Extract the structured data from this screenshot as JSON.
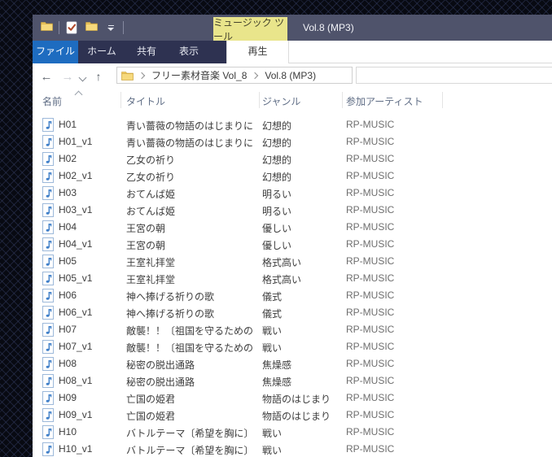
{
  "titlebar": {
    "contextual_tab": "ミュージック ツール",
    "title": "Vol.8 (MP3)"
  },
  "ribbon": {
    "file": "ファイル",
    "home": "ホーム",
    "share": "共有",
    "view": "表示",
    "play": "再生"
  },
  "nav": {
    "back": "←",
    "forward": "→",
    "up": "↑"
  },
  "breadcrumb": {
    "root_folder": "フリー素材音楽 Vol_8",
    "current": "Vol.8 (MP3)"
  },
  "columns": {
    "name": "名前",
    "title": "タイトル",
    "genre": "ジャンル",
    "artist": "参加アーティスト"
  },
  "colors": {
    "accent_blue": "#1e6cc0",
    "titlebar": "#4f536b",
    "tabstrip_dark": "#2e3251",
    "contextual_tab_yellow": "#e9e58b"
  },
  "rows": [
    {
      "name": "H01",
      "title": "青い薔薇の物語のはじまりに",
      "genre": "幻想的",
      "artist": "RP-MUSIC"
    },
    {
      "name": "H01_v1",
      "title": "青い薔薇の物語のはじまりに",
      "genre": "幻想的",
      "artist": "RP-MUSIC"
    },
    {
      "name": "H02",
      "title": "乙女の祈り",
      "genre": "幻想的",
      "artist": "RP-MUSIC"
    },
    {
      "name": "H02_v1",
      "title": "乙女の祈り",
      "genre": "幻想的",
      "artist": "RP-MUSIC"
    },
    {
      "name": "H03",
      "title": "おてんば姫",
      "genre": "明るい",
      "artist": "RP-MUSIC"
    },
    {
      "name": "H03_v1",
      "title": "おてんば姫",
      "genre": "明るい",
      "artist": "RP-MUSIC"
    },
    {
      "name": "H04",
      "title": "王宮の朝",
      "genre": "優しい",
      "artist": "RP-MUSIC"
    },
    {
      "name": "H04_v1",
      "title": "王宮の朝",
      "genre": "優しい",
      "artist": "RP-MUSIC"
    },
    {
      "name": "H05",
      "title": "王室礼拝堂",
      "genre": "格式高い",
      "artist": "RP-MUSIC"
    },
    {
      "name": "H05_v1",
      "title": "王室礼拝堂",
      "genre": "格式高い",
      "artist": "RP-MUSIC"
    },
    {
      "name": "H06",
      "title": "神へ捧げる祈りの歌",
      "genre": "儀式",
      "artist": "RP-MUSIC"
    },
    {
      "name": "H06_v1",
      "title": "神へ捧げる祈りの歌",
      "genre": "儀式",
      "artist": "RP-MUSIC"
    },
    {
      "name": "H07",
      "title": "敵襲！！〔祖国を守るための",
      "genre": "戦い",
      "artist": "RP-MUSIC"
    },
    {
      "name": "H07_v1",
      "title": "敵襲！！〔祖国を守るための",
      "genre": "戦い",
      "artist": "RP-MUSIC"
    },
    {
      "name": "H08",
      "title": "秘密の脱出通路",
      "genre": "焦燥感",
      "artist": "RP-MUSIC"
    },
    {
      "name": "H08_v1",
      "title": "秘密の脱出通路",
      "genre": "焦燥感",
      "artist": "RP-MUSIC"
    },
    {
      "name": "H09",
      "title": "亡国の姫君",
      "genre": "物語のはじまり",
      "artist": "RP-MUSIC"
    },
    {
      "name": "H09_v1",
      "title": "亡国の姫君",
      "genre": "物語のはじまり",
      "artist": "RP-MUSIC"
    },
    {
      "name": "H10",
      "title": "バトルテーマ〔希望を胸に〕",
      "genre": "戦い",
      "artist": "RP-MUSIC"
    },
    {
      "name": "H10_v1",
      "title": "バトルテーマ〔希望を胸に〕",
      "genre": "戦い",
      "artist": "RP-MUSIC"
    }
  ]
}
